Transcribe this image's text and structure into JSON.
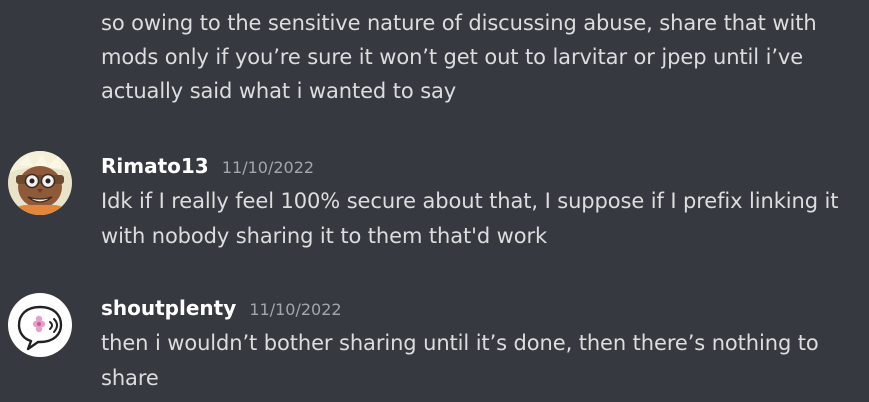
{
  "channel": {
    "messages": [
      {
        "continuation": true,
        "text": "so owing to the sensitive nature of discussing abuse, share that with mods only if you’re sure it won’t get out to larvitar or jpep until i’ve actually said what i wanted to say"
      },
      {
        "username": "Rimato13",
        "timestamp": "11/10/2022",
        "avatar_icon": "pirate-character-avatar",
        "text": "Idk if I really feel 100% secure about that, I suppose if I prefix linking it with nobody sharing it to them that'd work"
      },
      {
        "username": "shoutplenty",
        "timestamp": "11/10/2022",
        "avatar_icon": "speech-bubble-flower-avatar",
        "text": "then i wouldn’t bother sharing until it’s done, then there’s nothing to share"
      }
    ]
  },
  "colors": {
    "background": "#36393f",
    "message_text": "#dcddde",
    "username": "#ffffff",
    "timestamp": "#a3a6aa"
  }
}
